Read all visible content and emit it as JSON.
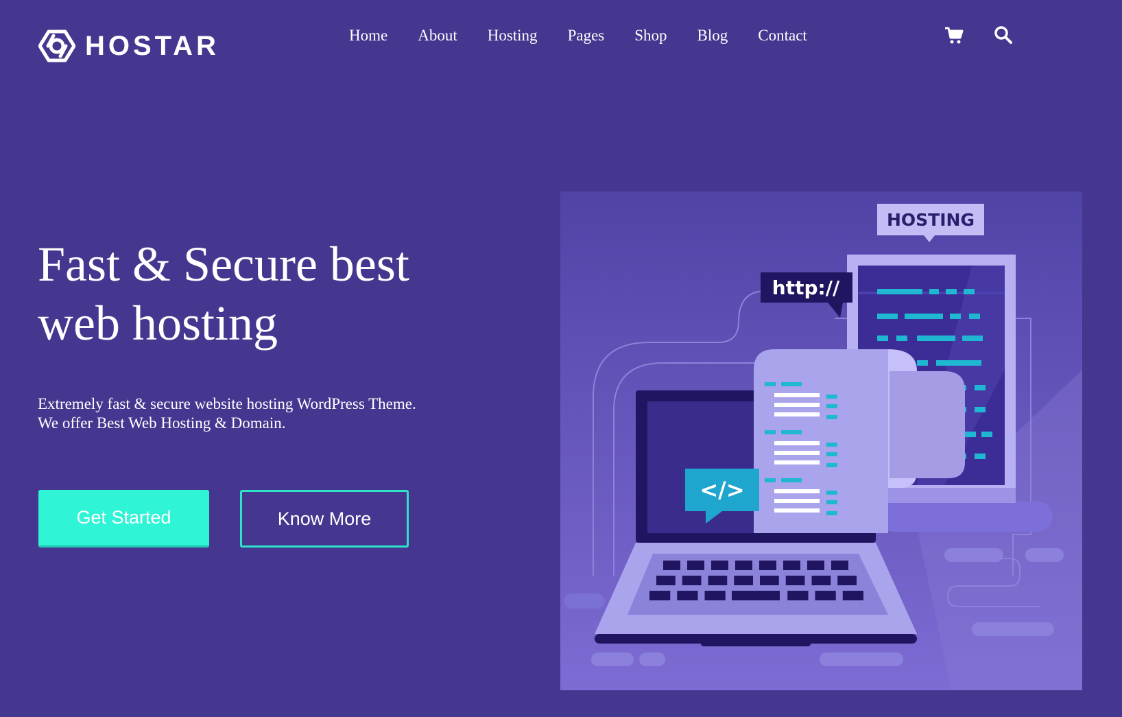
{
  "brand": {
    "name": "HOSTAR"
  },
  "nav": {
    "items": [
      {
        "label": "Home"
      },
      {
        "label": "About"
      },
      {
        "label": "Hosting"
      },
      {
        "label": "Pages"
      },
      {
        "label": "Shop"
      },
      {
        "label": "Blog"
      },
      {
        "label": "Contact"
      }
    ],
    "icons": [
      "cart-icon",
      "search-icon"
    ]
  },
  "hero": {
    "title_line1": "Fast & Secure best",
    "title_line2": "web hosting",
    "desc_line1": "Extremely fast & secure website hosting WordPress Theme.",
    "desc_line2": "We offer Best Web Hosting & Domain.",
    "primary_button": "Get Started",
    "secondary_button": "Know More"
  },
  "illustration": {
    "badge": "HOSTING",
    "url_label": "http://",
    "code_label": "</>"
  },
  "colors": {
    "background": "#45368f",
    "accent": "#2ff4d6",
    "outline": "#2ee3c9"
  }
}
